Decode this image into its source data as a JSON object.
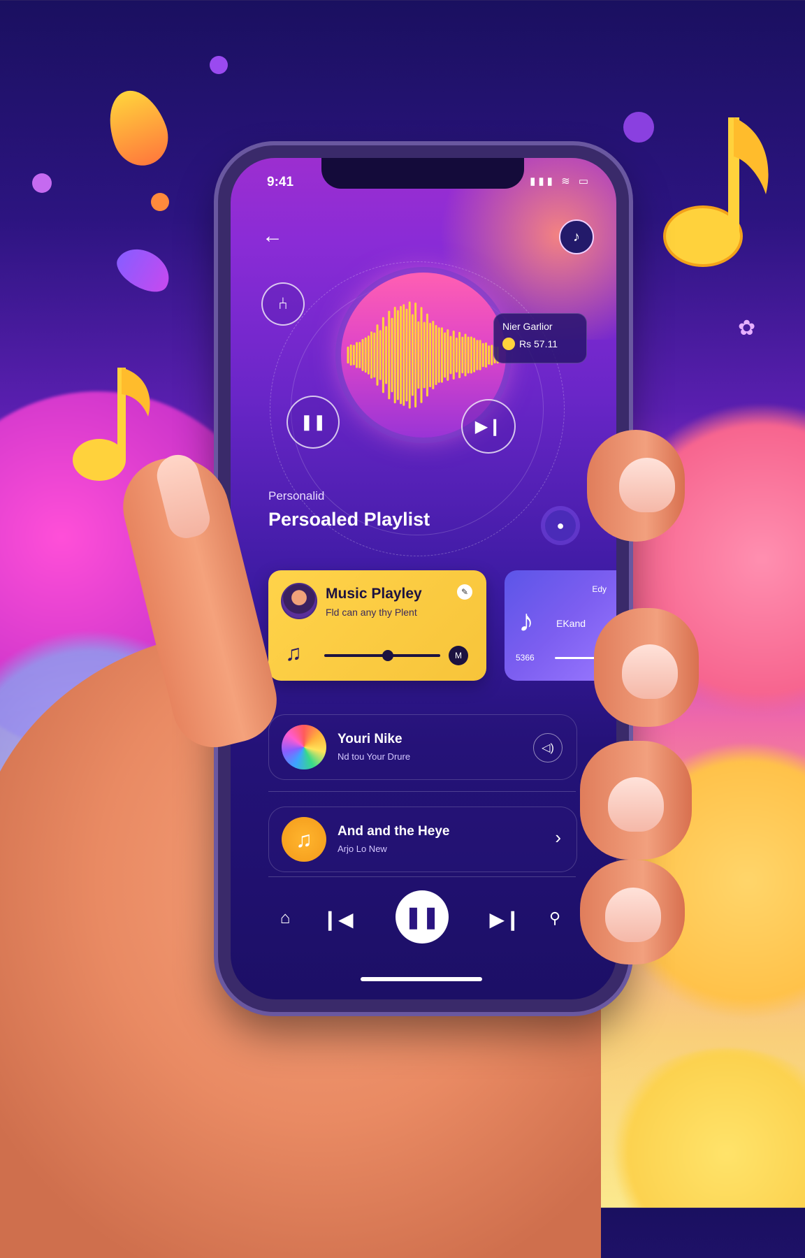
{
  "status": {
    "time": "9:41",
    "signal_icons": "▮▮▮ ≋ ▭"
  },
  "header": {
    "back_icon": "back-arrow-icon",
    "avatar_icon": "profile-avatar-icon"
  },
  "now_playing": {
    "tooltip_title": "Nier Garlior",
    "tooltip_value": "Rs 57.11"
  },
  "section": {
    "kicker": "Personalid",
    "title": "Persoaled Playlist"
  },
  "featured_card": {
    "title": "Music Playley",
    "subtitle": "Fld can any thy Plent",
    "badge": "M",
    "progress": 0.55
  },
  "side_card": {
    "label_top": "Edy",
    "label_mid": "EKand",
    "label_bottom": "5366"
  },
  "list": [
    {
      "title": "Youri Nike",
      "subtitle": "Nd tou Your Drure"
    },
    {
      "title": "And and the Heye",
      "subtitle": "Arjo Lo New"
    }
  ],
  "colors": {
    "accent_yellow": "#ffd34a",
    "accent_purple": "#6a26c8",
    "accent_pink": "#ff5fb2"
  }
}
